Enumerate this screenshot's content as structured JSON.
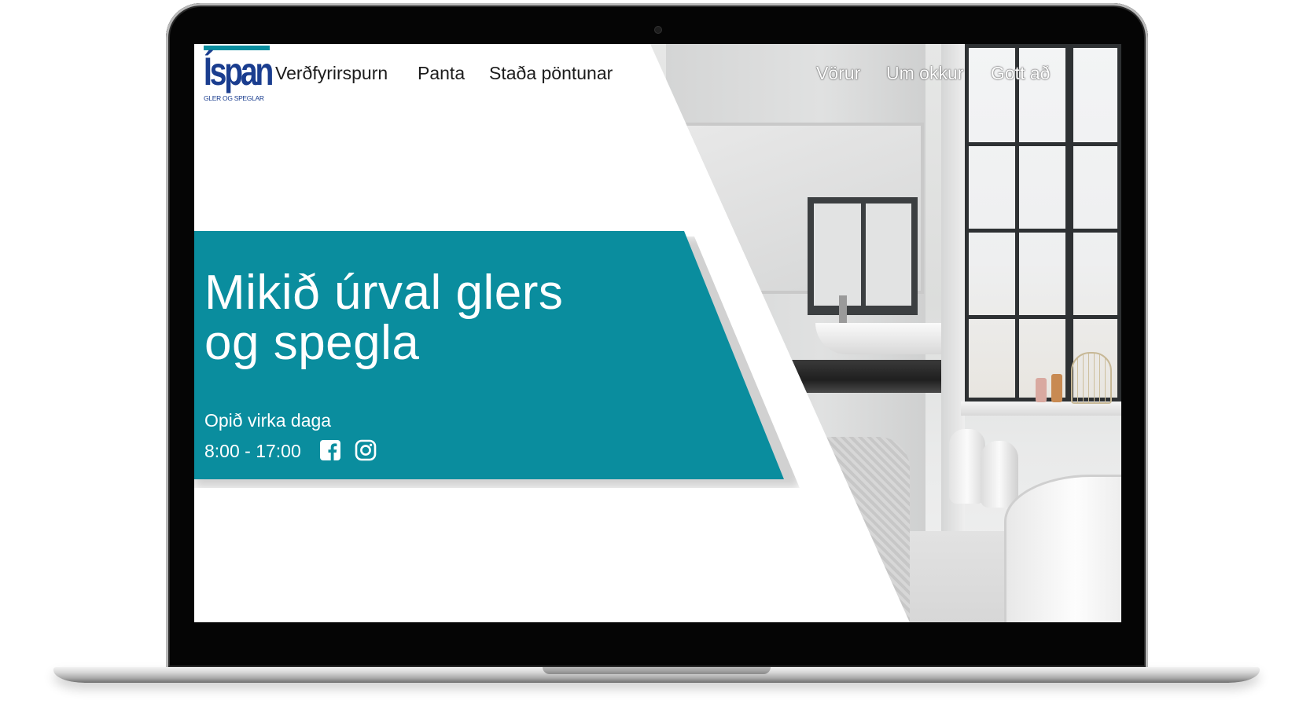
{
  "brand": {
    "logo_text": "Íspan",
    "logo_subtitle": "GLER OG SPEGLAR",
    "colors": {
      "teal": "#0a8d9e",
      "navy": "#1a3d8f"
    }
  },
  "nav": {
    "left": [
      {
        "label": "Verðfyrirspurn"
      },
      {
        "label": "Panta"
      },
      {
        "label": "Staða pöntunar"
      }
    ],
    "right": [
      {
        "label": "Vörur"
      },
      {
        "label": "Um okkur"
      },
      {
        "label": "Gott að"
      }
    ]
  },
  "hero": {
    "headline_line1": "Mikið úrval glers",
    "headline_line2": "og spegla",
    "hours_label": "Opið virka daga",
    "hours_value": "8:00 - 17:00",
    "social": [
      {
        "icon": "facebook-icon"
      },
      {
        "icon": "instagram-icon"
      }
    ]
  }
}
